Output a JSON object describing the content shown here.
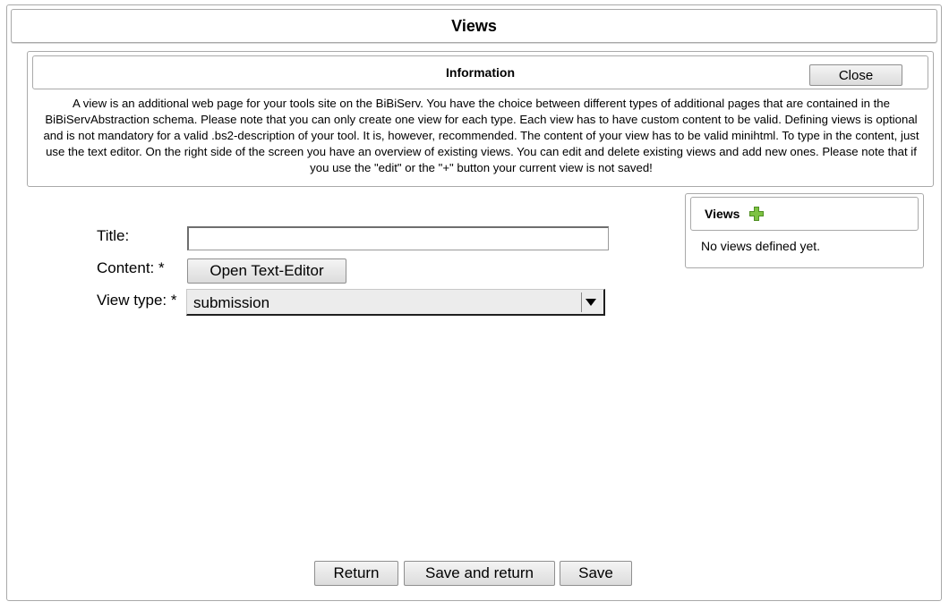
{
  "header": {
    "title": "Views"
  },
  "info": {
    "title": "Information",
    "close_label": "Close",
    "text": "A view is an additional web page for your tools site on the BiBiServ. You have the choice between different types of additional pages that are contained in the BiBiServAbstraction schema. Please note that you can only create one view for each type. Each view has to have custom content to be valid. Defining views is optional and is not mandatory for a valid .bs2-description of your tool. It is, however, recommended. The content of your view has to be valid minihtml. To type in the content, just use the text editor. On the right side of the screen you have an overview of existing views. You can edit and delete existing views and add new ones. Please note that if you use the \"edit\" or the \"+\" button your current view is not saved!"
  },
  "views_panel": {
    "title": "Views",
    "add_icon": "plus-icon",
    "add_icon_color": "#7dc242",
    "empty_text": "No views defined yet."
  },
  "form": {
    "title_label": "Title:",
    "title_value": "",
    "content_label": "Content: *",
    "editor_button": "Open Text-Editor",
    "view_type_label": "View type: *",
    "view_type_value": "submission"
  },
  "footer": {
    "return_label": "Return",
    "save_return_label": "Save and return",
    "save_label": "Save"
  }
}
